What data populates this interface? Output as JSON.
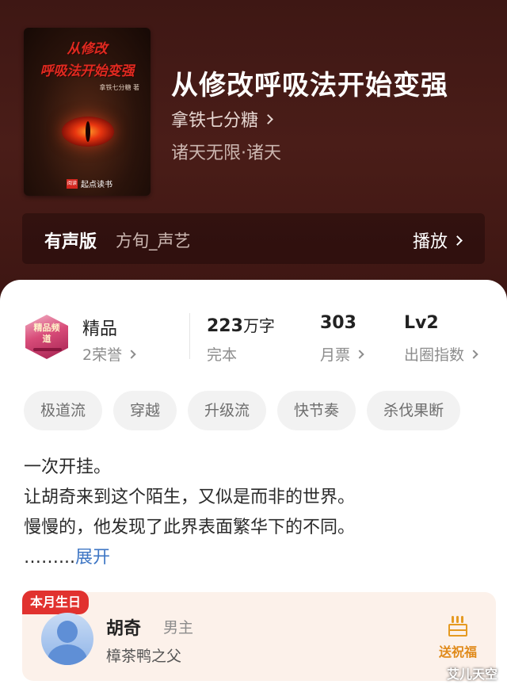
{
  "book": {
    "title": "从修改呼吸法开始变强",
    "author": "拿铁七分糖",
    "genre": "诸天无限·诸天",
    "cover": {
      "title_line1": "从修改",
      "title_line2": "呼吸法开始变强",
      "author_credit": "拿铁七分糖 著",
      "publisher": "起点读书",
      "publisher_mark": "阅读"
    }
  },
  "audio": {
    "label": "有声版",
    "narrator": "方旬_声艺",
    "play_label": "播放"
  },
  "stats": {
    "medal_text": "精品频道",
    "quality_label": "精品",
    "honors": "2荣誉",
    "word_count": "223",
    "word_unit": "万字",
    "status": "完本",
    "monthly_tickets": "303",
    "monthly_label": "月票",
    "level": "Lv2",
    "level_label": "出圈指数"
  },
  "tags": [
    "极道流",
    "穿越",
    "升级流",
    "快节奏",
    "杀伐果断"
  ],
  "description": {
    "line1": "一次开挂。",
    "line2": "让胡奇来到这个陌生，又似是而非的世界。",
    "line3": "慢慢的，他发现了此界表面繁华下的不同。",
    "ellipsis": "……...",
    "expand": "展开"
  },
  "character": {
    "badge": "本月生日",
    "name": "胡奇",
    "role": "男主",
    "title": "樟茶鸭之父",
    "gift_label": "送祝福"
  },
  "watermark": "艾儿天空"
}
